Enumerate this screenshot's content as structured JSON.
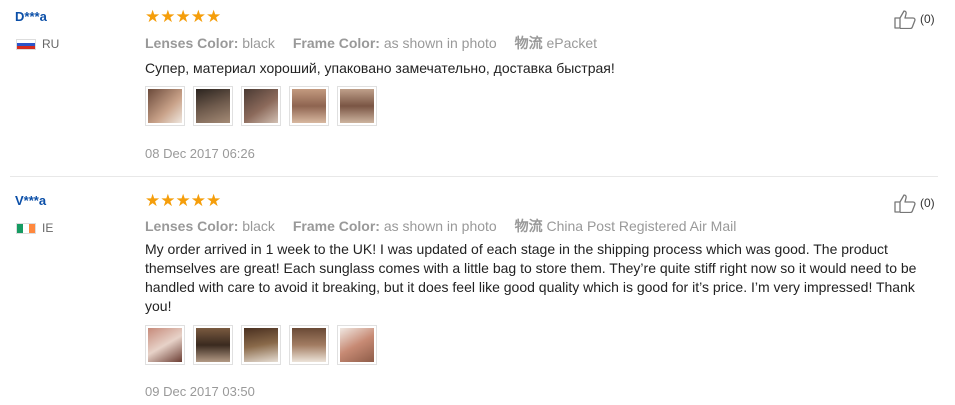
{
  "reviews": [
    {
      "user": "D***a",
      "country": "RU",
      "stars": "★★★★★",
      "rating": 5,
      "likes": "(0)",
      "lenses_label": "Lenses Color:",
      "lenses_value": "black",
      "frame_label": "Frame Color:",
      "frame_value": "as shown in photo",
      "shipping_label": "物流",
      "shipping_value": "ePacket",
      "text": "Супер, материал хороший, упаковано замечательно, доставка быстрая!",
      "photo_count": 5,
      "date": "08 Dec 2017 06:26"
    },
    {
      "user": "V***a",
      "country": "IE",
      "stars": "★★★★★",
      "rating": 5,
      "likes": "(0)",
      "lenses_label": "Lenses Color:",
      "lenses_value": "black",
      "frame_label": "Frame Color:",
      "frame_value": "as shown in photo",
      "shipping_label": "物流",
      "shipping_value": "China Post Registered Air Mail",
      "text": "My order arrived in 1 week to the UK! I was updated of each stage in the shipping process which was good. The product themselves are great! Each sunglass comes with a little bag to store them. They’re quite stiff right now so it would need to be handled with care to avoid it breaking, but it does feel like good quality which is good for it’s price. I’m very impressed! Thank you!",
      "photo_count": 5,
      "date": "09 Dec 2017 03:50"
    }
  ]
}
